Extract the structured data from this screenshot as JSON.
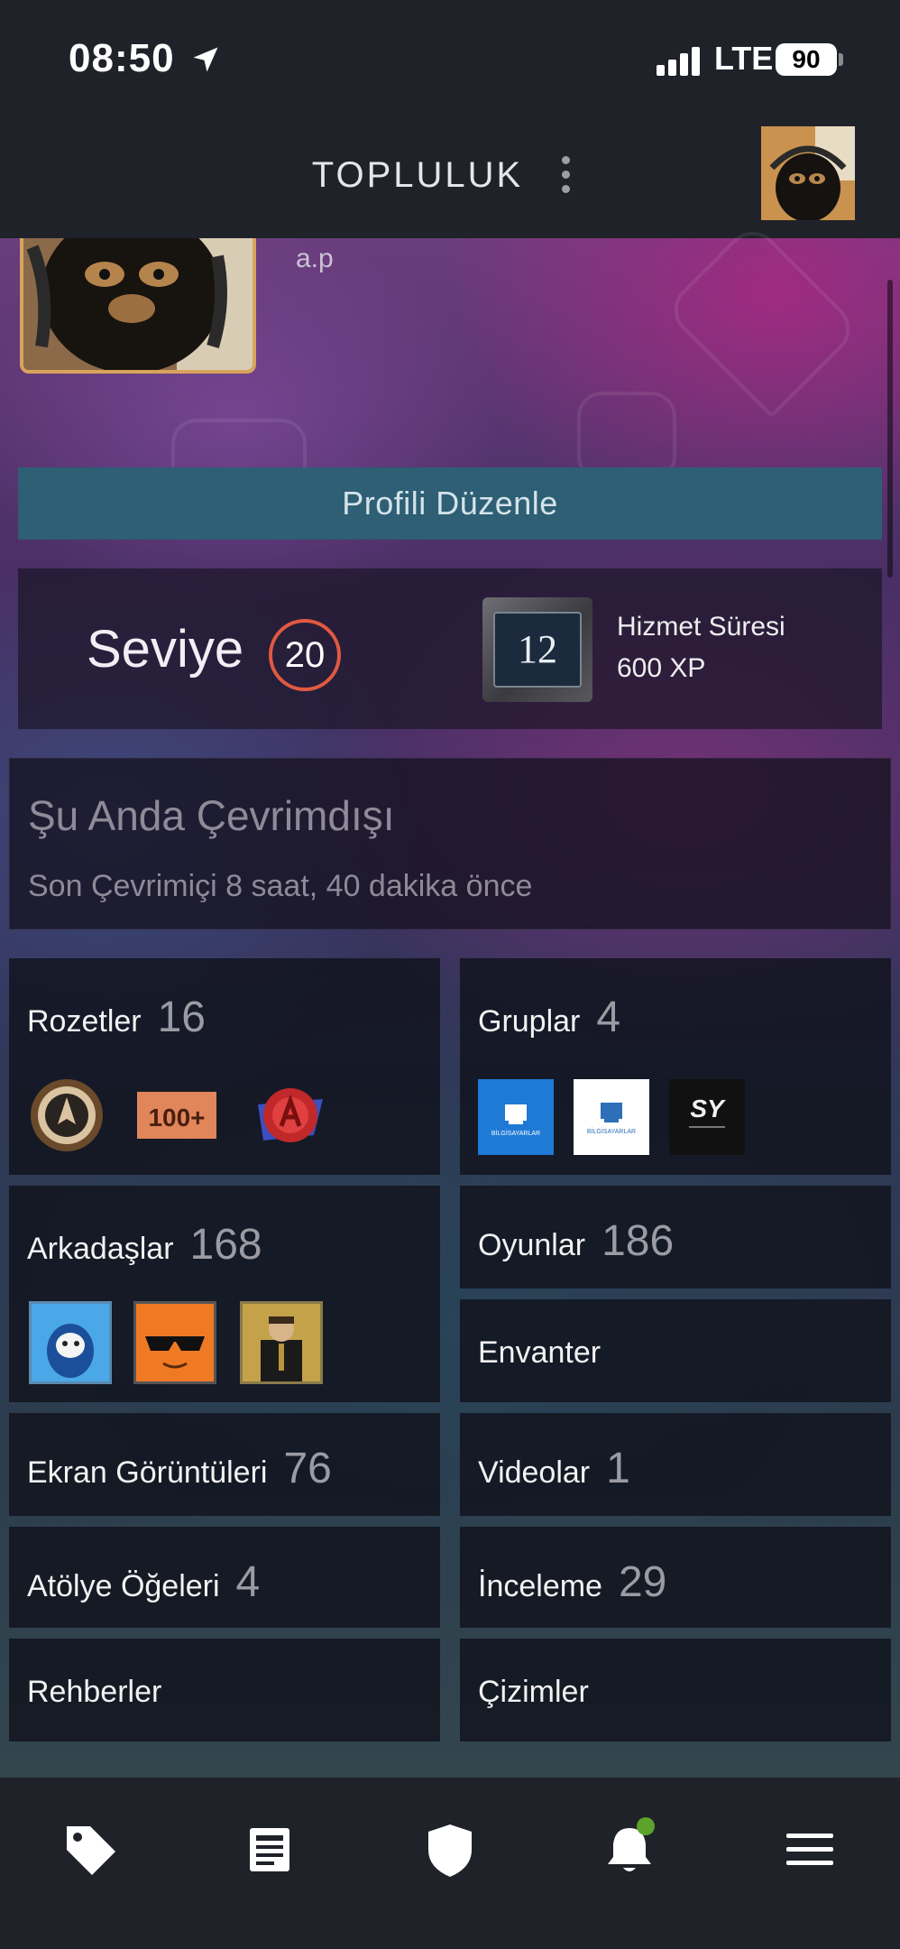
{
  "status_bar": {
    "time": "08:50",
    "network": "LTE",
    "battery": "90"
  },
  "header": {
    "title": "TOPLULUK"
  },
  "profile": {
    "name": "a.p",
    "edit_button": "Profili Düzenle",
    "level_label": "Seviye",
    "level": "20",
    "badge_number": "12",
    "badge_title": "Hizmet Süresi",
    "badge_xp": "600 XP",
    "status_title": "Şu Anda Çevrimdışı",
    "status_sub": "Son Çevrimiçi 8 saat, 40 dakika önce"
  },
  "tiles": {
    "badges": {
      "label": "Rozetler",
      "count": "16"
    },
    "badge_thumbs": {
      "second_text": "100+"
    },
    "groups": {
      "label": "Gruplar",
      "count": "4"
    },
    "friends": {
      "label": "Arkadaşlar",
      "count": "168"
    },
    "games": {
      "label": "Oyunlar",
      "count": "186"
    },
    "inventory": {
      "label": "Envanter"
    },
    "screenshots": {
      "label": "Ekran Görüntüleri",
      "count": "76"
    },
    "videos": {
      "label": "Videolar",
      "count": "1"
    },
    "workshop": {
      "label": "Atölye Öğeleri",
      "count": "4"
    },
    "reviews": {
      "label": "İnceleme",
      "count": "29"
    },
    "guides": {
      "label": "Rehberler"
    },
    "artwork": {
      "label": "Çizimler"
    }
  },
  "group_thumbs": [
    "BİLGİSAYARLAR",
    "BİLGİSAYARLAR",
    "SY"
  ],
  "bottom_nav": [
    "tag-icon",
    "news-icon",
    "shield-icon",
    "bell-icon",
    "menu-icon"
  ],
  "colors": {
    "accent_button": "#2e5f74",
    "level_ring": "#e05a40",
    "nav_bg": "#1f2229",
    "notification_dot": "#5ba32b"
  }
}
